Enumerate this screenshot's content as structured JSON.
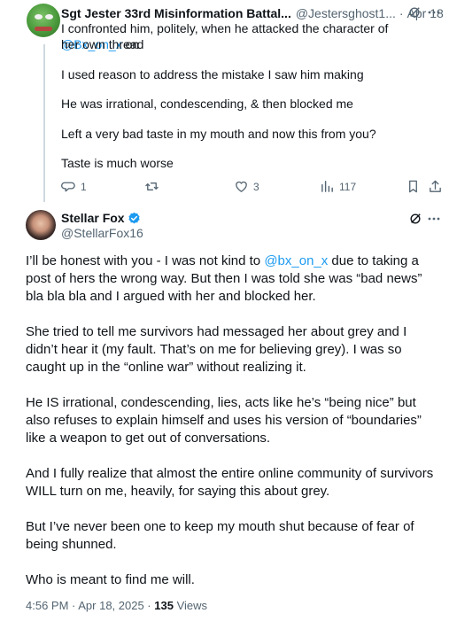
{
  "reply": {
    "author_name": "Sgt Jester 33rd Misinformation Battal...",
    "handle": "@Jestersghost1...",
    "separator": "·",
    "date": "Apr 18",
    "text_before_mention": "I confronted him, politely, when he attacked the character of ",
    "mention": "@Bx_on_x",
    "text_after_mention": " on",
    "line2": "her own thread",
    "paragraphs": [
      "I used reason to address the mistake I saw him making",
      "He was irrational, condescending, & then blocked me",
      "Left a very bad taste in my mouth and now this from you?",
      "Taste is much worse"
    ],
    "replies": "1",
    "likes": "3",
    "views": "117"
  },
  "post": {
    "author_name": "Stellar Fox",
    "handle": "@StellarFox16",
    "p1_before": "I’ll be honest with you - I was not kind to ",
    "p1_mention": "@bx_on_x",
    "p1_after": " due to taking a post of hers the wrong way. But then I was told she was “bad news” bla bla bla and I argued with her and blocked her.",
    "p2": "She tried to tell me survivors had messaged her about grey and I didn’t hear it (my fault. That’s on me for believing grey). I was so caught up in the “online war” without realizing it.",
    "p3": "He IS irrational, condescending, lies, acts like he’s “being nice” but also refuses to explain himself and uses his version of “boundaries” like a weapon to get out of conversations.",
    "p4": "And I fully realize that almost the entire online community of survivors WILL turn on me, heavily, for saying this about grey.",
    "p5": "But I’ve never been one to keep my mouth shut because of fear of being shunned.",
    "p6": "Who is meant to find me will.",
    "time": "4:56 PM · Apr 18, 2025 · ",
    "views": "135",
    "views_label": " Views"
  },
  "colors": {
    "accent": "#1d9bf0",
    "muted": "#536471",
    "text": "#0f1419"
  }
}
